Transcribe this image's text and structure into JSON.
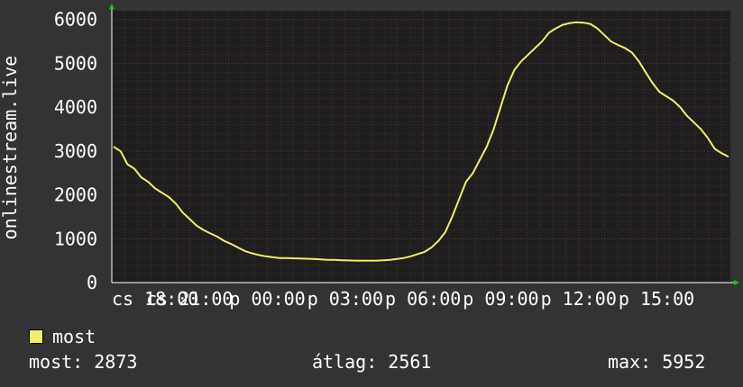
{
  "colors": {
    "background": "#333333",
    "plot_background": "#1e1e1e",
    "grid_minor": "#4a2f2f",
    "grid_major": "#7a2a2a",
    "line": "#f2ee6a",
    "text": "#ffffff",
    "axis_arrow": "#00cc00"
  },
  "chart_data": {
    "type": "line",
    "title": "",
    "ylabel": "onlinestream.live",
    "xlabel": "",
    "ylim": [
      0,
      6200
    ],
    "yticks": [
      0,
      1000,
      2000,
      3000,
      4000,
      5000,
      6000
    ],
    "x_tick_labels": [
      "cs 18:00",
      "cs 21:00",
      "p 00:00",
      "p 03:00",
      "p 06:00",
      "p 09:00",
      "p 12:00",
      "p 15:00"
    ],
    "grid": true,
    "legend": "bottom-left",
    "series": [
      {
        "name": "most",
        "values": [
          3100,
          3000,
          2700,
          2600,
          2400,
          2300,
          2150,
          2050,
          1950,
          1800,
          1600,
          1450,
          1300,
          1200,
          1120,
          1050,
          950,
          880,
          800,
          720,
          670,
          630,
          600,
          580,
          560,
          560,
          555,
          550,
          545,
          540,
          530,
          520,
          520,
          510,
          505,
          500,
          500,
          500,
          500,
          510,
          520,
          540,
          560,
          600,
          650,
          700,
          800,
          950,
          1150,
          1500,
          1900,
          2300,
          2500,
          2800,
          3100,
          3500,
          4000,
          4500,
          4850,
          5050,
          5200,
          5350,
          5500,
          5700,
          5800,
          5880,
          5920,
          5940,
          5930,
          5900,
          5800,
          5650,
          5500,
          5420,
          5350,
          5250,
          5050,
          4800,
          4550,
          4350,
          4250,
          4150,
          4000,
          3800,
          3650,
          3500,
          3300,
          3050,
          2950,
          2873
        ]
      }
    ]
  },
  "legend": {
    "label": "most"
  },
  "stats": {
    "current": "most: 2873",
    "average": "átlag: 2561",
    "maximum": "max: 5952"
  }
}
